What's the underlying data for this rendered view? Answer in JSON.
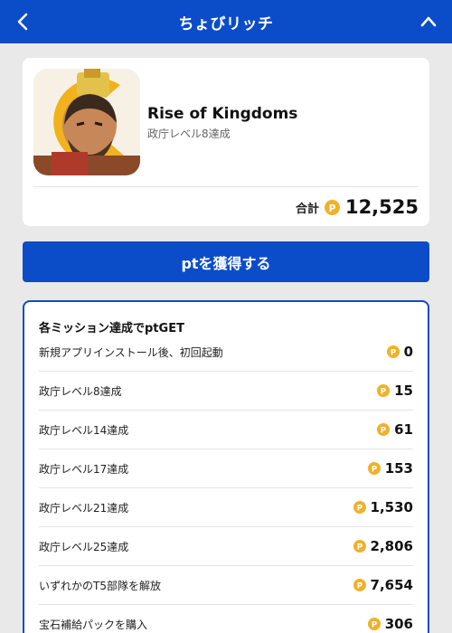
{
  "header": {
    "title": "ちょびリッチ"
  },
  "app": {
    "name": "Rise of Kingdoms",
    "subtitle": "政庁レベル8達成",
    "total_label": "合計",
    "total_value": "12,525"
  },
  "cta": {
    "label": "ptを獲得する"
  },
  "missions": {
    "title": "各ミッション達成でptGET",
    "items": [
      {
        "label": "新規アプリインストール後、初回起動",
        "points": "0"
      },
      {
        "label": "政庁レベル8達成",
        "points": "15"
      },
      {
        "label": "政庁レベル14達成",
        "points": "61"
      },
      {
        "label": "政庁レベル17達成",
        "points": "153"
      },
      {
        "label": "政庁レベル21達成",
        "points": "1,530"
      },
      {
        "label": "政庁レベル25達成",
        "points": "2,806"
      },
      {
        "label": "いずれかのT5部隊を解放",
        "points": "7,654"
      },
      {
        "label": "宝石補給パックを購入",
        "points": "306"
      }
    ]
  },
  "icons": {
    "back": "chevron-left-icon",
    "collapse": "chevron-up-icon",
    "coin": "point-coin-icon"
  },
  "colors": {
    "brand_blue": "#0b4cc9",
    "coin_gold": "#f0b12b",
    "background": "#e9e9e9"
  }
}
